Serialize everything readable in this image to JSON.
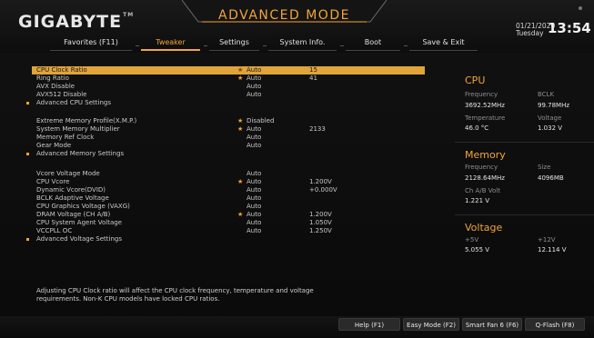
{
  "header": {
    "logo": "GIGABYTE",
    "logo_tm": "TM",
    "mode": "ADVANCED MODE",
    "date": "01/21/2020",
    "weekday": "Tuesday",
    "time": "13:54"
  },
  "tabs": [
    {
      "label": "Favorites (F11)",
      "active": false
    },
    {
      "label": "Tweaker",
      "active": true
    },
    {
      "label": "Settings",
      "active": false
    },
    {
      "label": "System Info.",
      "active": false
    },
    {
      "label": "Boot",
      "active": false
    },
    {
      "label": "Save & Exit",
      "active": false
    }
  ],
  "rows": [
    {
      "label": "CPU Clock Ratio",
      "star": "★",
      "setting": "Auto",
      "value": "15"
    },
    {
      "label": "Ring Ratio",
      "star": "★",
      "setting": "Auto",
      "value": "41"
    },
    {
      "label": "AVX Disable",
      "star": "",
      "setting": "Auto",
      "value": ""
    },
    {
      "label": "AVX512 Disable",
      "star": "",
      "setting": "Auto",
      "value": ""
    },
    {
      "label": "Advanced CPU Settings",
      "star": "",
      "setting": "",
      "value": ""
    },
    {
      "label": "Extreme Memory Profile(X.M.P.)",
      "star": "★",
      "setting": "Disabled",
      "value": ""
    },
    {
      "label": "System Memory Multiplier",
      "star": "★",
      "setting": "Auto",
      "value": "2133"
    },
    {
      "label": "Memory Ref Clock",
      "star": "",
      "setting": "Auto",
      "value": ""
    },
    {
      "label": "Gear Mode",
      "star": "",
      "setting": "Auto",
      "value": ""
    },
    {
      "label": "Advanced Memory Settings",
      "star": "",
      "setting": "",
      "value": ""
    },
    {
      "label": "Vcore Voltage Mode",
      "star": "",
      "setting": "Auto",
      "value": ""
    },
    {
      "label": "CPU Vcore",
      "star": "★",
      "setting": "Auto",
      "value": "1.200V"
    },
    {
      "label": "Dynamic Vcore(DVID)",
      "star": "",
      "setting": "Auto",
      "value": "+0.000V"
    },
    {
      "label": "BCLK Adaptive Voltage",
      "star": "",
      "setting": "Auto",
      "value": ""
    },
    {
      "label": "CPU Graphics Voltage (VAXG)",
      "star": "",
      "setting": "Auto",
      "value": ""
    },
    {
      "label": "DRAM Voltage    (CH A/B)",
      "star": "★",
      "setting": "Auto",
      "value": "1.200V"
    },
    {
      "label": "CPU System Agent Voltage",
      "star": "",
      "setting": "Auto",
      "value": "1.050V"
    },
    {
      "label": "VCCPLL OC",
      "star": "",
      "setting": "Auto",
      "value": "1.250V"
    },
    {
      "label": "Advanced Voltage Settings",
      "star": "",
      "setting": "",
      "value": ""
    }
  ],
  "side": {
    "cpu_title": "CPU",
    "freq_label": "Frequency",
    "bclk_label": "BCLK",
    "freq_val": "3692.52MHz",
    "bclk_val": "99.78MHz",
    "temp_label": "Temperature",
    "volt_label": "Voltage",
    "temp_val": "46.0 °C",
    "volt_val": "1.032 V",
    "mem_title": "Memory",
    "mem_freq_label": "Frequency",
    "size_label": "Size",
    "mem_freq_val": "2128.64MHz",
    "size_val": "4096MB",
    "chab_label": "Ch A/B Volt",
    "chab_val": "1.221 V",
    "volt_title": "Voltage",
    "p5v_label": "+5V",
    "p12v_label": "+12V",
    "p5v_val": "5.055 V",
    "p12v_val": "12.114 V"
  },
  "help": {
    "line1": "Adjusting CPU Clock ratio will affect the CPU clock frequency, temperature and voltage",
    "line2": "requirements. Non-K CPU models have locked CPU ratios."
  },
  "footer": {
    "help": "Help (F1)",
    "easy": "Easy Mode (F2)",
    "fan": "Smart Fan 6 (F6)",
    "qflash": "Q-Flash (F8)"
  },
  "colors": {
    "accent": "#f3a536",
    "selected_row": "#e0a43a"
  }
}
